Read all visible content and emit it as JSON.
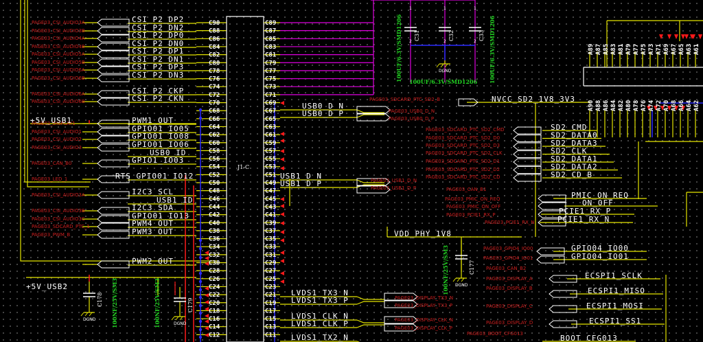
{
  "connector": {
    "ref": "J1-C",
    "left_pins": [
      "C90",
      "C88",
      "C86",
      "C84",
      "C82",
      "C80",
      "C78",
      "C76",
      "C74",
      "C72",
      "C70",
      "C68",
      "C66",
      "C64",
      "C62",
      "C60",
      "C58",
      "C56",
      "C54",
      "C52",
      "C50",
      "C48",
      "C46",
      "C44",
      "C42",
      "C40",
      "C38",
      "C36",
      "C34",
      "C32",
      "C30",
      "C28",
      "C26",
      "C24",
      "C22",
      "C20",
      "C18",
      "C16",
      "C14",
      "C12",
      "C10"
    ],
    "right_pins": [
      "C89",
      "C87",
      "C85",
      "C83",
      "C81",
      "C79",
      "C77",
      "C75",
      "C73",
      "C71",
      "C69",
      "C67",
      "C65",
      "C63",
      "C61",
      "C59",
      "C57",
      "C55",
      "C53",
      "C51",
      "C49",
      "C47",
      "C45",
      "C43",
      "C41",
      "C39",
      "C37",
      "C35",
      "C33",
      "C31",
      "C29",
      "C27",
      "C25",
      "C23",
      "C21",
      "C19",
      "C17",
      "C15",
      "C13",
      "C11",
      "C9"
    ]
  },
  "left_nets": [
    "CSI_P2_DP2",
    "CSI_P2_DN2",
    "CSI_P2_DP0",
    "CSI_P2_DN0",
    "CSI_P2_DP1",
    "CSI_P2_DN1",
    "CSI_P2_DP3",
    "CSI_P2_DN3",
    "CSI_P2_CKP",
    "CSI_P2_CKN",
    "PWM1_OUT",
    "GPIO01_IO05",
    "GPIO01_IO08",
    "GPIO01_IO06",
    "USB0_ID",
    "GPIO1_IO03",
    "RTS_GPIO01_IO12",
    "I2C3_SCL",
    "USB1_ID",
    "I2C3_SDA",
    "GPIO01_IO13",
    "PWM4_OUT",
    "PWM3_OUT",
    "PWM2_OUT"
  ],
  "power": {
    "usb1": "+5V_USB1",
    "usb2": "+5V_USB2",
    "vdd_phy": "VDD_PHY_1V8",
    "nvcc_sd2": "NVCC_SD2_1V8_3V3"
  },
  "right_nets": [
    "USB0_D_N",
    "USB0_D_P",
    "USB1_D_N",
    "USB1_D_P",
    "LVDS1_TX3_N",
    "LVDS1_TX3_P",
    "LVDS1_CLK_N",
    "LVDS1_CLK_P",
    "LVDS1_TX2_N"
  ],
  "sd_nets": [
    "SD2_CMD",
    "SD2_DATA0",
    "SD2_DATA3",
    "SD2_CLK",
    "SD2_DATA1",
    "SD2_DATA2",
    "SD2_CD_B"
  ],
  "misc_nets": [
    "PMIC_ON_REQ",
    "ON_OFF",
    "PCIE1_RX_P",
    "PCIE1_RX_N",
    "GPIO04_IO00",
    "GPIO04_IO01",
    "ECSPI1_SCLK",
    "ECSPI1_MISO",
    "ECSPI1_MOSI",
    "ECSPI1_SS1",
    "BOOT_CFG013"
  ],
  "capacitors": {
    "c31": "C31",
    "c32": "C32",
    "c33": "C33",
    "c177": "C177",
    "c178": "C178",
    "c179": "C179",
    "bulk_value": "100UF/6.3V/SMD1206",
    "small_value": "100NF/25V/SM3",
    "ground": "DGND"
  },
  "top_pins": [
    "A89",
    "A87",
    "A85",
    "A83",
    "A81",
    "A79",
    "A77",
    "A75",
    "A73",
    "A71",
    "A69",
    "A67",
    "A65",
    "A63",
    "A61"
  ],
  "row_pins": [
    "A90",
    "A88",
    "A86",
    "A84",
    "A82",
    "A80",
    "A78",
    "A76",
    "A74",
    "A72",
    "A70",
    "A68",
    "A66",
    "A64",
    "A62"
  ],
  "ports_left": [
    "PAGE03_CSI_AUDIO3A",
    "PAGE03_CSI_AUDIO3B",
    "PAGE03_CSI_AUDIO4A",
    "PAGE03_CSI_AUDIO4B",
    "PAGE03_CSI_AUDIO5A",
    "PAGE03_CSI_AUDIO5B",
    "PAGE03_CSI_AUDIO6A",
    "PAGE03_CSI_AUDIO6B",
    "PAGE03_CSI_AUDIO6A",
    "PAGE03_CSI_AUDIO6B",
    "PAGE03_DISPLAY1",
    "PAGE03_CSI_AUDIO1",
    "PAGE03_CSI_AUDIO2",
    "PAGE03_CSI_AUDIO3",
    "PAGE03_CAN_B0",
    "PAGE03_LED_1",
    "PAGE03_CSI_AUDIO3A",
    "PAGE03_CSI_AUDIO3B",
    "PAGE03_CSI_AUDIO3C",
    "PAGE03_SDCARD_PTC_1",
    "PAGE03_PWM_B"
  ],
  "ports_right": [
    "PAGE03_SDCARD_PTC_SD2_B",
    "PAGE03_USB0_D_N",
    "PAGE03_USB0_D_P",
    "PAGE03_SDCARD_PTC_SD2_CMD",
    "PAGE03_SDCARD_PTC_SD2_D0",
    "PAGE03_SDCARD_PTC_SD2_D3",
    "PAGE03_SDCARD_PTC_SD2_CLK",
    "PAGE03_SDCARD_PTC_SD2_D1",
    "PAGE03_SDCARD_PTC_SD2_D2",
    "PAGE03_SDCARD_PTC_SD2_CD",
    "PAGE03_USB1_D_N",
    "PAGE03_USB1_D_P",
    "PAGE03_CAN_B1",
    "PAGE03_PMIC_ON_REQ",
    "PAGE03_PMIC_ON_OFF",
    "PAGE03_PCIE1_RX_P",
    "PAGE03_PCIE1_RX_N",
    "PAGE03_GPIO4_IO00",
    "PAGE03_GPIO4_IO01",
    "PAGE03_DISPLAY_TX3_N",
    "PAGE03_DISPLAY_TX3_P",
    "PAGE03_DISPLAY_CLK_N",
    "PAGE03_DISPLAY_CLK_P",
    "PAGE03_CAN_B2",
    "PAGE03_DISPLAY_A",
    "PAGE03_DISPLAY_B",
    "PAGE03_DISPLAY_C",
    "PAGE03_DISPLAY_D",
    "PAGE03_BOOT_CFG013"
  ],
  "colors": {
    "wire": "#e5e500",
    "bus": "#e000e0",
    "blue": "#2a2aff",
    "red": "#ff1a1a",
    "green": "#22d022",
    "port": "#cc1f1f"
  }
}
